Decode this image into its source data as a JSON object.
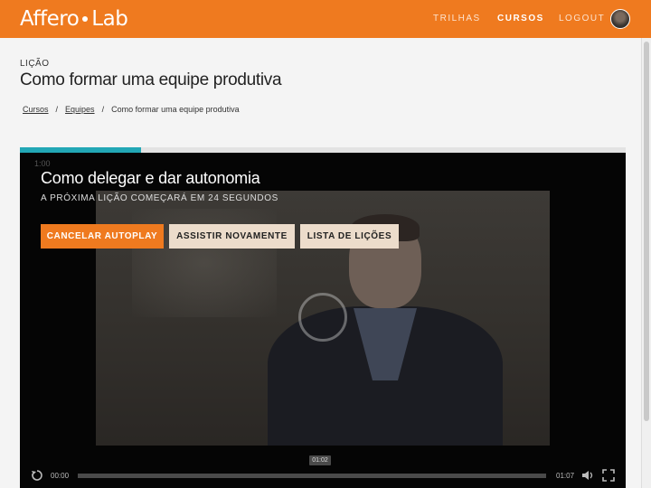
{
  "header": {
    "logo_left": "Affero",
    "logo_right": "Lab",
    "nav": [
      {
        "label": "TRILHAS",
        "active": false
      },
      {
        "label": "CURSOS",
        "active": true
      },
      {
        "label": "LOGOUT",
        "active": false
      }
    ]
  },
  "lesson": {
    "kicker": "LIÇÃO",
    "title": "Como formar uma equipe produtiva"
  },
  "breadcrumb": {
    "items": [
      "Cursos",
      "Equipes",
      "Como formar uma equipe produtiva"
    ],
    "separator": "/"
  },
  "progress": {
    "fraction": 0.2
  },
  "player": {
    "ghost_time": "1:00",
    "next_title": "Como delegar e dar autonomia",
    "next_subtitle": "A PRÓXIMA LIÇÃO COMEÇARÁ EM 24 SEGUNDOS",
    "buttons": {
      "cancel": "CANCELAR AUTOPLAY",
      "replay": "ASSISTIR NOVAMENTE",
      "list": "LISTA DE LIÇÕES"
    },
    "controls": {
      "current_time": "00:00",
      "duration": "01:07",
      "hover_time": "01:02"
    }
  },
  "colors": {
    "brand": "#ef7a1f",
    "progress": "#22a7b5"
  }
}
